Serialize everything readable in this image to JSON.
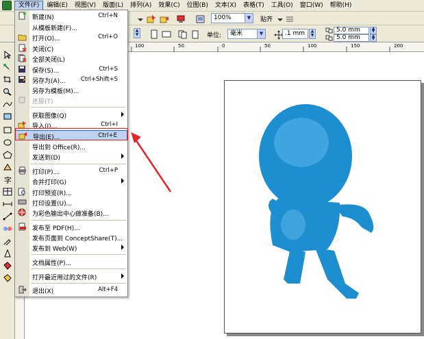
{
  "menubar": {
    "items": [
      {
        "label": "文件(F)"
      },
      {
        "label": "编辑(E)"
      },
      {
        "label": "视图(V)"
      },
      {
        "label": "版面(L)"
      },
      {
        "label": "排列(A)"
      },
      {
        "label": "效果(C)"
      },
      {
        "label": "位图(B)"
      },
      {
        "label": "文本(X)"
      },
      {
        "label": "表格(T)"
      },
      {
        "label": "工具(O)"
      },
      {
        "label": "窗口(W)"
      },
      {
        "label": "帮助(H)"
      }
    ],
    "active_index": 0
  },
  "toolbar1": {
    "zoom_value": "100%",
    "snap_label": "贴齐"
  },
  "toolbar2": {
    "unit_label": "单位:",
    "unit_value": "毫米",
    "nudge_value": ".1 mm",
    "dup_x": "5.0 mm",
    "dup_y": "5.0 mm"
  },
  "ruler": {
    "h_labels": [
      "100",
      "50",
      "0",
      "50",
      "100",
      "150",
      "200"
    ],
    "h_prefix": "00"
  },
  "file_menu": {
    "items": [
      {
        "label": "新建(N)",
        "shortcut": "Ctrl+N"
      },
      {
        "label": "从模板新建(F)...",
        "shortcut": ""
      },
      {
        "label": "打开(O)...",
        "shortcut": "Ctrl+O"
      },
      {
        "label": "关闭(C)",
        "shortcut": ""
      },
      {
        "label": "全部关闭(L)",
        "shortcut": ""
      },
      {
        "label": "保存(S)...",
        "shortcut": "Ctrl+S"
      },
      {
        "label": "另存为(A)...",
        "shortcut": "Ctrl+Shift+S"
      },
      {
        "label": "另存为模板(M)...",
        "shortcut": ""
      },
      {
        "label": "还原(T)",
        "shortcut": ""
      },
      {
        "label": "获取图像(Q)",
        "shortcut": ""
      },
      {
        "label": "导入(I)...",
        "shortcut": "Ctrl+I"
      },
      {
        "label": "导出(E)...",
        "shortcut": "Ctrl+E"
      },
      {
        "label": "导出到 Office(R)...",
        "shortcut": ""
      },
      {
        "label": "发送到(D)",
        "shortcut": ""
      },
      {
        "label": "打印(P)...",
        "shortcut": "Ctrl+P"
      },
      {
        "label": "合并打印(G)",
        "shortcut": ""
      },
      {
        "label": "打印预览(R)...",
        "shortcut": ""
      },
      {
        "label": "打印设置(U)...",
        "shortcut": ""
      },
      {
        "label": "为彩色输出中心做准备(B)...",
        "shortcut": ""
      },
      {
        "label": "发布至 PDF(H)...",
        "shortcut": ""
      },
      {
        "label": "发布页面到 ConceptShare(T)...",
        "shortcut": ""
      },
      {
        "label": "发布到 Web(W)",
        "shortcut": ""
      },
      {
        "label": "文档属性(P)...",
        "shortcut": ""
      },
      {
        "label": "打开最近用过的文件(R)",
        "shortcut": ""
      },
      {
        "label": "退出(X)",
        "shortcut": "Alt+F4"
      }
    ]
  },
  "colors": {
    "highlight_red": "#e0262a",
    "figure_blue": "#1d8fd0",
    "menu_select": "#c1d2ee"
  }
}
